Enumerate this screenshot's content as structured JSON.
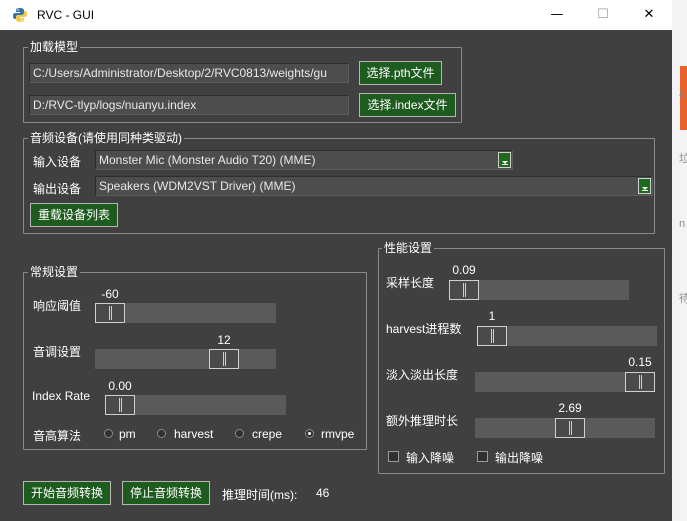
{
  "window": {
    "title": "RVC - GUI",
    "minimize": "—",
    "maximize": "☐",
    "close": "✕"
  },
  "load_model": {
    "legend": "加载模型",
    "pth_path": "C:/Users/Administrator/Desktop/2/RVC0813/weights/gu",
    "pth_button": "选择.pth文件",
    "index_path": "D:/RVC-tlyp/logs/nuanyu.index",
    "index_button": "选择.index文件"
  },
  "audio_devices": {
    "legend": "音频设备(请使用同种类驱动)",
    "input_label": "输入设备",
    "input_value": "Monster Mic (Monster Audio T20) (MME)",
    "output_label": "输出设备",
    "output_value": "Speakers (WDM2VST Driver) (MME)",
    "reload_button": "重载设备列表"
  },
  "general": {
    "legend": "常规设置",
    "threshold_label": "响应阈值",
    "threshold_value": "-60",
    "threshold_level": 0,
    "pitch_label": "音调设置",
    "pitch_value": "12",
    "pitch_level": 0.6667,
    "index_rate_label": "Index Rate",
    "index_rate_value": "0.00",
    "index_rate_level": 0,
    "f0_label": "音高算法",
    "f0_options": [
      "pm",
      "harvest",
      "crepe",
      "rmvpe"
    ],
    "f0_selected": "rmvpe"
  },
  "performance": {
    "legend": "性能设置",
    "sample_length_label": "采样长度",
    "sample_length_value": "0.09",
    "harvest_label": "harvest进程数",
    "harvest_value": "1",
    "fade_label": "淡入淡出长度",
    "fade_value": "0.15",
    "extra_label": "额外推理时长",
    "extra_value": "2.69",
    "input_denoise_label": "输入降噪",
    "output_denoise_label": "输出降噪",
    "input_denoise_checked": false,
    "output_denoise_checked": false
  },
  "footer": {
    "start_button": "开始音频转换",
    "stop_button": "停止音频转换",
    "infer_time_label": "推理时间(ms):",
    "infer_time_value": "46"
  },
  "colors": {
    "background": "#404040",
    "button_green": "#1e5b1e",
    "track": "#5a5a5a",
    "field": "#4d4d4d"
  },
  "icons": {
    "app": "python-icon",
    "background_chars": [
      "a",
      "垃",
      "n",
      "待"
    ]
  }
}
